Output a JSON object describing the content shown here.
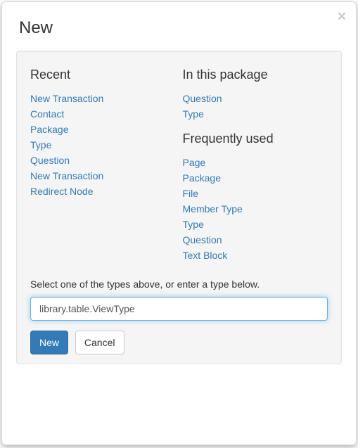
{
  "title": "New",
  "close_label": "×",
  "sections": {
    "recent": {
      "heading": "Recent",
      "items": [
        "New Transaction",
        "Contact",
        "Package",
        "Type",
        "Question",
        "New Transaction",
        "Redirect Node"
      ]
    },
    "in_package": {
      "heading": "In this package",
      "items": [
        "Question",
        "Type"
      ]
    },
    "frequent": {
      "heading": "Frequently used",
      "items": [
        "Page",
        "Package",
        "File",
        "Member Type",
        "Type",
        "Question",
        "Text Block"
      ]
    }
  },
  "hint": "Select one of the types above, or enter a type below.",
  "input": {
    "value": "library.table.ViewType"
  },
  "buttons": {
    "new_label": "New",
    "cancel_label": "Cancel"
  }
}
